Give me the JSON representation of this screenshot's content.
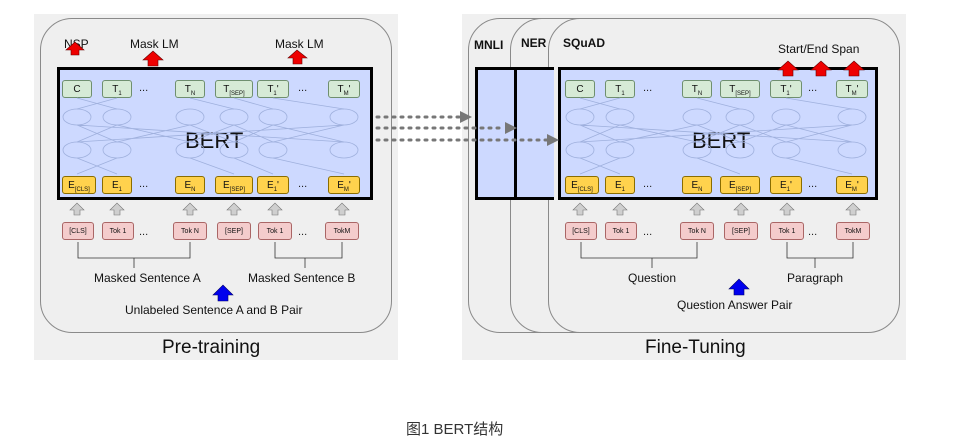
{
  "pretraining": {
    "title": "Pre-training",
    "model_label": "BERT",
    "heads": {
      "nsp": "NSP",
      "mask_lm_1": "Mask LM",
      "mask_lm_2": "Mask LM"
    },
    "outputs": [
      "C",
      "T1",
      "TN",
      "T[SEP]",
      "T1'",
      "TM'"
    ],
    "embeddings": [
      "E[CLS]",
      "E1",
      "EN",
      "E[SEP]",
      "E1'",
      "EM'"
    ],
    "inputs": [
      "[CLS]",
      "Tok 1",
      "Tok N",
      "[SEP]",
      "Tok 1",
      "TokM"
    ],
    "sentence_a": "Masked Sentence A",
    "sentence_b": "Masked Sentence B",
    "pair": "Unlabeled Sentence A and B Pair"
  },
  "finetuning": {
    "title": "Fine-Tuning",
    "tasks": [
      "MNLI",
      "NER",
      "SQuAD"
    ],
    "model_label": "BERT",
    "span": "Start/End Span",
    "outputs": [
      "C",
      "T1",
      "TN",
      "T[SEP]",
      "T1'",
      "TM'"
    ],
    "embeddings": [
      "E[CLS]",
      "E1",
      "EN",
      "E[SEP]",
      "E1'",
      "EM'"
    ],
    "inputs": [
      "[CLS]",
      "Tok 1",
      "Tok N",
      "[SEP]",
      "Tok 1",
      "TokM"
    ],
    "question": "Question",
    "paragraph": "Paragraph",
    "pair": "Question Answer Pair"
  },
  "ellipsis": "...",
  "caption": "图1 BERT结构",
  "colors": {
    "background_panel": "#f0f0f0",
    "bert_fill": "#cdd9ff",
    "output_token": "#d6ead6",
    "embedding_token": "#ffd24d",
    "input_token": "#f4cccc",
    "up_arrow_red": "#ee0000",
    "up_arrow_blue": "#0000ee"
  }
}
